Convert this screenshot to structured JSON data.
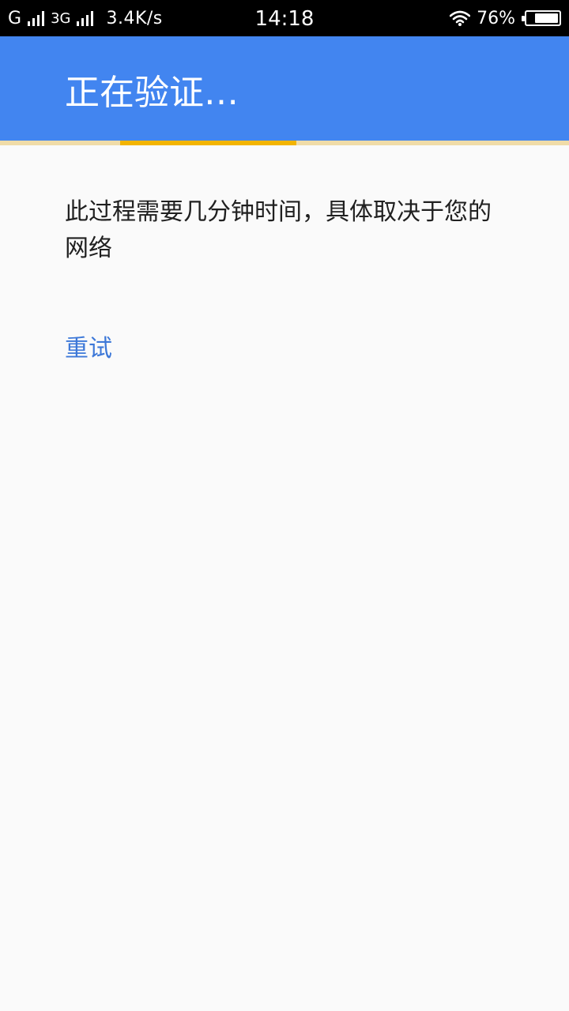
{
  "status_bar": {
    "carrier1": "G",
    "carrier2": "3G",
    "speed": "3.4K/s",
    "time": "14:18",
    "battery_percent": "76%",
    "battery_level": 0.76,
    "icons": [
      "signal-icon",
      "signal-icon",
      "wifi-icon",
      "battery-icon"
    ]
  },
  "app_bar": {
    "title": "正在验证…",
    "background": "#4285f0"
  },
  "progress": {
    "indeterminate": true,
    "track_color": "#f0dca8",
    "bar_color": "#f2b400"
  },
  "main": {
    "message": "此过程需要几分钟时间，具体取决于您的网络",
    "retry_label": "重试",
    "link_color": "#3d78d8"
  }
}
